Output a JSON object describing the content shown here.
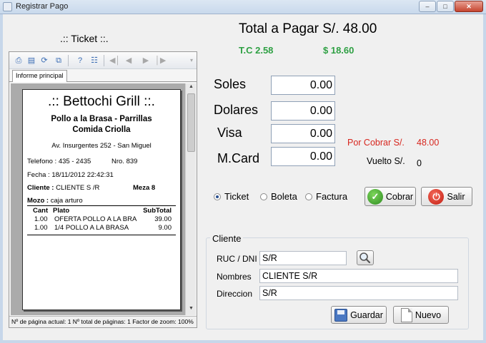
{
  "window": {
    "title": "Registrar Pago",
    "minimize_glyph": "–",
    "maximize_glyph": "□",
    "close_glyph": "✕"
  },
  "ticket_panel": {
    "heading": ".:: Ticket ::.",
    "tab_label": "Informe principal",
    "status_text": "Nº de página actual: 1 Nº total de páginas: 1 Factor de zoom: 100%",
    "toolbar_icons": [
      "print-icon",
      "page-setup-icon",
      "refresh-icon",
      "export-icon",
      "help-icon",
      "tree-icon",
      "first-page-icon",
      "prev-page-icon",
      "next-page-icon",
      "last-page-icon"
    ],
    "receipt": {
      "restaurant_name": ".:: Bettochi Grill ::.",
      "subtitle_1": "Pollo a la Brasa - Parrillas",
      "subtitle_2": "Comida Criolla",
      "address": "Av. Insurgentes 252 - San Miguel",
      "phone": "Telefono : 435 - 2435",
      "number": "Nro. 839",
      "date": "Fecha : 18/11/2012  22:42:31",
      "client_label": "Cliente :",
      "client_value": "CLIENTE S /R",
      "table": "Meza 8",
      "waiter_label": "Mozo :",
      "waiter_value": "caja arturo",
      "columns": {
        "qty": "Cant",
        "item": "Plato",
        "subtotal": "SubTotal"
      },
      "items": [
        {
          "qty": "1.00",
          "item": "OFERTA POLLO A LA BRA",
          "subtotal": "39.00"
        },
        {
          "qty": "1.00",
          "item": "1/4 POLLO A LA BRASA",
          "subtotal": "9.00"
        }
      ]
    }
  },
  "totals": {
    "total_label": "Total a Pagar  S/.  48.00",
    "tc_label": "T.C  2.58",
    "usd_label": "$  18.60"
  },
  "payment": {
    "soles_label": "Soles",
    "soles_value": "0.00",
    "dolares_label": "Dolares",
    "dolares_value": "0.00",
    "visa_label": "Visa",
    "visa_value": "0.00",
    "mcard_label": "M.Card",
    "mcard_value": "0.00",
    "por_cobrar_label": "Por Cobrar S/.",
    "por_cobrar_value": "48.00",
    "vuelto_label": "Vuelto S/.",
    "vuelto_value": "0"
  },
  "document_type": {
    "selected": "Ticket",
    "options": [
      "Ticket",
      "Boleta",
      "Factura"
    ]
  },
  "actions": {
    "cobrar_label": "Cobrar",
    "salir_label": "Salir"
  },
  "cliente": {
    "group_title": "Cliente",
    "ruc_label": "RUC / DNI",
    "ruc_value": "S/R",
    "nombres_label": "Nombres",
    "nombres_value": "CLIENTE S/R",
    "direccion_label": "Direccion",
    "direccion_value": "S/R",
    "guardar_label": "Guardar",
    "nuevo_label": "Nuevo"
  },
  "colors": {
    "accent_green": "#2ea043",
    "alert_red": "#d7261e"
  }
}
